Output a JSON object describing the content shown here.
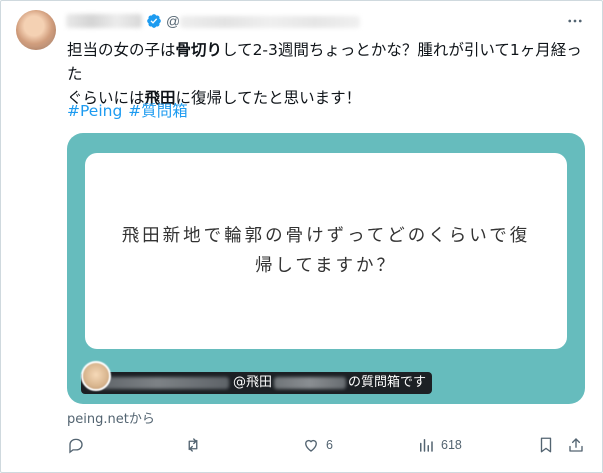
{
  "post": {
    "at_sign": "@",
    "text_segments": [
      "担当の女の子は",
      "骨切り",
      "して2-3週間ちょっとかな？腫れが引いて1ヶ月経った",
      "ぐらいには",
      "飛田",
      "に復帰してたと思います！"
    ],
    "hashtags": [
      "#Peing",
      "#質問箱"
    ],
    "source": "peing.netから"
  },
  "card": {
    "question": "飛田新地で輪郭の骨けずってどのくらいで復帰してますか？",
    "caption_mid": "@飛田",
    "caption_end": "の質問箱です",
    "background_color": "#66bcbd"
  },
  "actions": {
    "reply_count": "",
    "retweet_count": "",
    "like_count": "6",
    "views_count": "618"
  },
  "icons": [
    "verified-badge-icon",
    "more-icon",
    "reply-icon",
    "retweet-icon",
    "like-icon",
    "views-icon",
    "bookmark-icon",
    "share-icon"
  ],
  "colors": {
    "link": "#1d9bf0",
    "muted": "#536471",
    "text": "#0f1419"
  }
}
